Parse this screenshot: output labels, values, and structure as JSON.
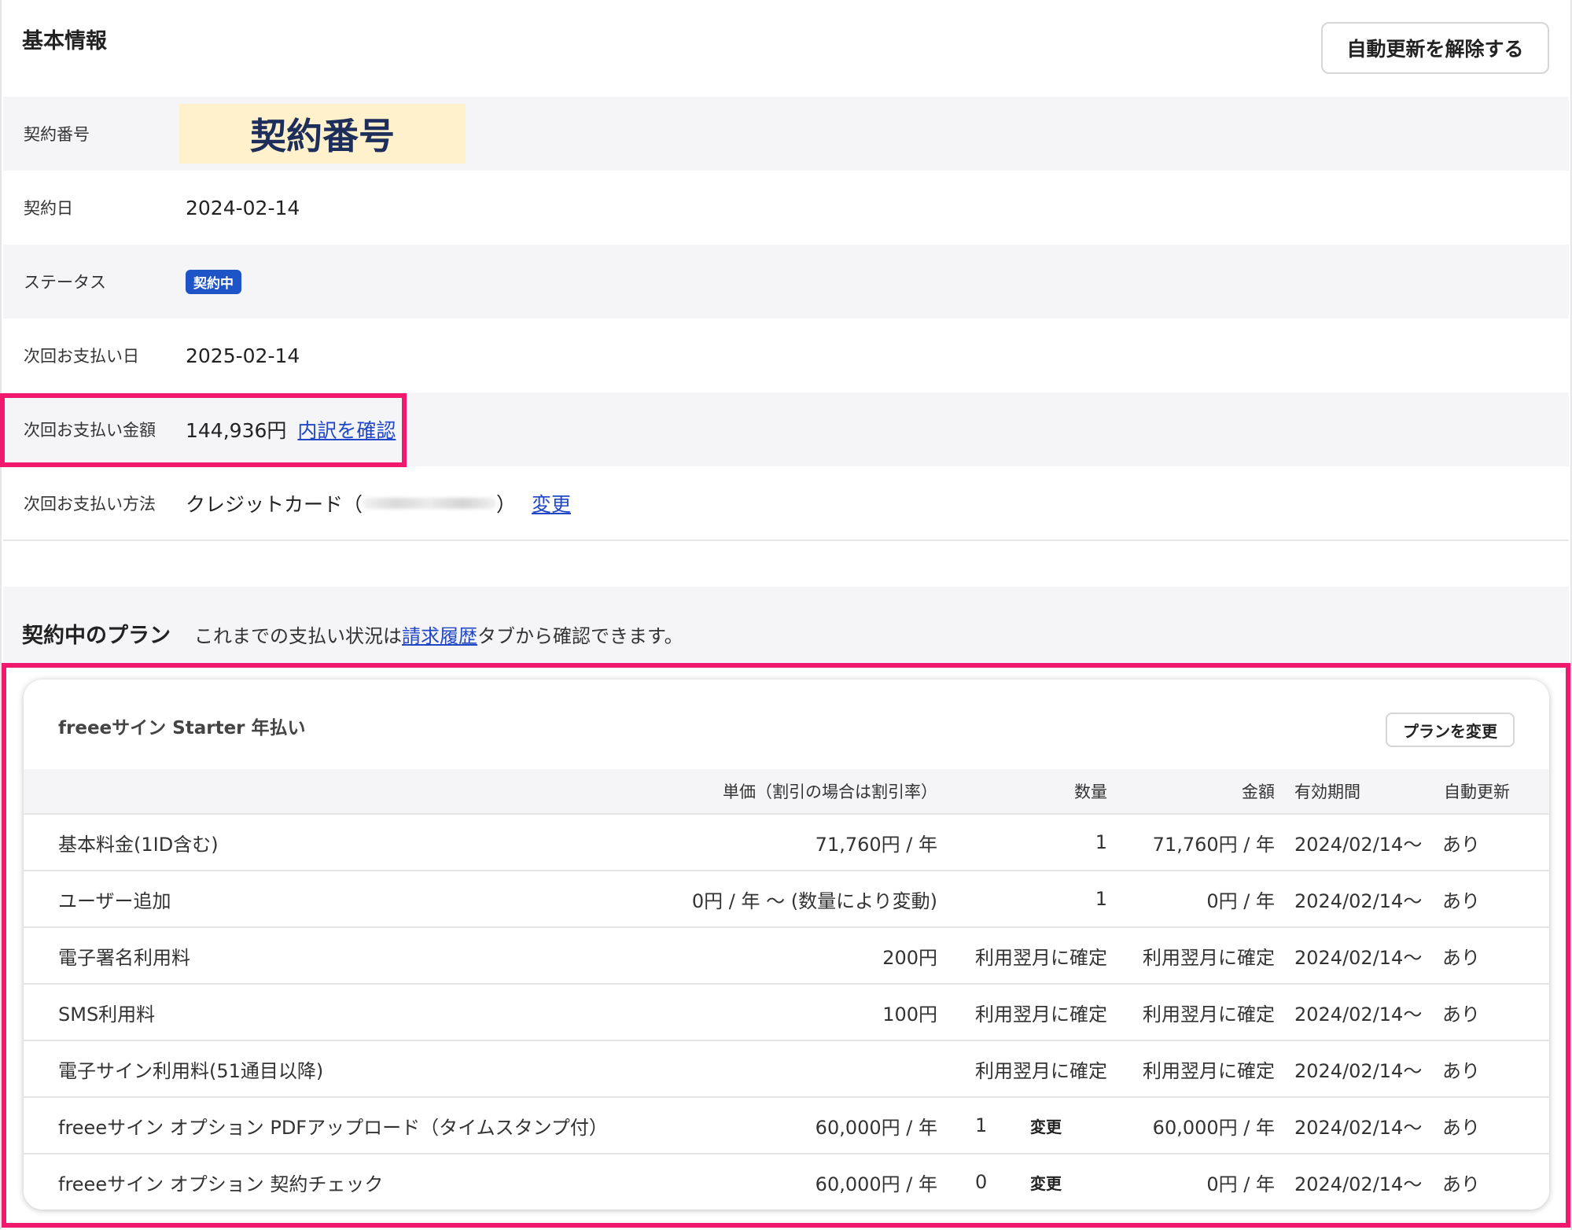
{
  "basic_info": {
    "title": "基本情報",
    "cancel_auto_renew_label": "自動更新を解除する",
    "contract_number": {
      "label": "契約番号",
      "value": "契約番号"
    },
    "contract_date": {
      "label": "契約日",
      "value": "2024-02-14"
    },
    "status": {
      "label": "ステータス",
      "value": "契約中"
    },
    "next_payment_date": {
      "label": "次回お支払い日",
      "value": "2025-02-14"
    },
    "next_payment_amount": {
      "label": "次回お支払い金額",
      "value": "144,936円",
      "link": "内訳を確認"
    },
    "next_payment_method": {
      "label": "次回お支払い方法",
      "value_prefix": "クレジットカード（",
      "value_suffix": "）",
      "link": "変更"
    }
  },
  "plans": {
    "title": "契約中のプラン",
    "note_before": "これまでの支払い状況は",
    "note_link": "請求履歴",
    "note_after": "タブから確認できます。",
    "card": {
      "plan_name": "freeeサイン Starter 年払い",
      "change_plan_label": "プランを変更",
      "columns": {
        "unit_price": "単価（割引の場合は割引率）",
        "quantity": "数量",
        "amount": "金額",
        "period": "有効期間",
        "auto_renew": "自動更新"
      },
      "rows": [
        {
          "name": "基本料金(1ID含む)",
          "unit_price": "71,760円 / 年",
          "quantity": "1",
          "amount": "71,760円 / 年",
          "period": "2024/02/14〜",
          "auto_renew": "あり"
        },
        {
          "name": "ユーザー追加",
          "unit_price": "0円 / 年 〜 (数量により変動)",
          "quantity": "1",
          "amount": "0円 / 年",
          "period": "2024/02/14〜",
          "auto_renew": "あり"
        },
        {
          "name": "電子署名利用料",
          "unit_price": "200円",
          "quantity": "利用翌月に確定",
          "amount": "利用翌月に確定",
          "period": "2024/02/14〜",
          "auto_renew": "あり"
        },
        {
          "name": "SMS利用料",
          "unit_price": "100円",
          "quantity": "利用翌月に確定",
          "amount": "利用翌月に確定",
          "period": "2024/02/14〜",
          "auto_renew": "あり"
        },
        {
          "name": "電子サイン利用料(51通目以降)",
          "unit_price": "",
          "quantity": "利用翌月に確定",
          "amount": "利用翌月に確定",
          "period": "2024/02/14〜",
          "auto_renew": "あり"
        },
        {
          "name": "freeeサイン オプション PDFアップロード（タイムスタンプ付）",
          "unit_price": "60,000円 / 年",
          "quantity": "1",
          "change_label": "変更",
          "amount": "60,000円 / 年",
          "period": "2024/02/14〜",
          "auto_renew": "あり"
        },
        {
          "name": "freeeサイン オプション 契約チェック",
          "unit_price": "60,000円 / 年",
          "quantity": "0",
          "change_label": "変更",
          "amount": "0円 / 年",
          "period": "2024/02/14〜",
          "auto_renew": "あり"
        }
      ]
    }
  },
  "colors": {
    "highlight": "#f0196d",
    "link": "#1f47c6",
    "badge": "#1f54c7",
    "row_gray": "#f5f4f6"
  }
}
